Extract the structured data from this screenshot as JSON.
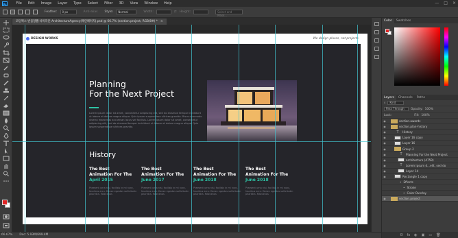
{
  "menubar": {
    "app_icon": "Ps",
    "items": [
      "File",
      "Edit",
      "Image",
      "Layer",
      "Type",
      "Select",
      "Filter",
      "3D",
      "View",
      "Window",
      "Help"
    ],
    "controls": [
      "—",
      "□",
      "×"
    ]
  },
  "options": {
    "feather_label": "Feather:",
    "feather_value": "0 px",
    "antialias_label": "Anti-alias",
    "style_label": "Style:",
    "style_value": "Normal",
    "width_label": "Width:",
    "height_label": "Height:",
    "select_mask_label": "Select and Mask..."
  },
  "doc_tab": {
    "title": "코딩웍스-반응형웹-사이자인-ArchitectureAgency(메인페이지).psd @ 66.7% (section.project, RGB/8#) *",
    "close": "×"
  },
  "canvas": {
    "brand": "DESIGN WORKS",
    "tagline": "We design places, not projects.",
    "heading_line1": "Planning",
    "heading_line2": "For the Next Project",
    "lorem": "Lorem ipsum dolor sit amet, consectetur adipiscing elit, sed do eiusmod tempor incididunt ut labore et dolore magna aliqua. Quis ipsum suspendisse ultrices gravida. Risus commodo viverra maecenas accumsan lacus vel facilisis. Lorem ipsum dolor sit amet, consectetur adipiscing elit, sed do eiusmod tempor incididunt ut labore et dolore magna aliqua. Quis ipsum suspendisse ultrices gravida.",
    "history_title": "History",
    "history": [
      {
        "line1": "The Best",
        "line2": "Animation For The",
        "date": "April 2015",
        "text": "Praesent urna nisi, facilisis in mi nunc, faucibus arcu. Donec egestas sollicitudin pharetra. Maecenas"
      },
      {
        "line1": "The Best",
        "line2": "Animation For The",
        "date": "June 2017",
        "text": "Praesent urna nisi, facilisis in mi nunc, faucibus arcu. Donec egestas sollicitudin pharetra. Maecenas"
      },
      {
        "line1": "The Best",
        "line2": "Animation For The",
        "date": "June 2018",
        "text": "Praesent urna nisi, facilisis in mi nunc, faucibus arcu. Donec egestas sollicitudin pharetra. Maecenas"
      },
      {
        "line1": "The Best",
        "line2": "Animation For The",
        "date": "June 2018",
        "text": "Praesent urna nisi, facilisis in mi nunc, faucibus arcu. Donec egestas sollicitudin pharetra. Maecenas"
      }
    ]
  },
  "status": {
    "zoom": "66.67%",
    "doc": "Doc: 5.93M/699.4M"
  },
  "color_panel": {
    "tabs": [
      "Color",
      "Swatches"
    ],
    "fg_color": "#e02424",
    "bg_color": "#ffffff"
  },
  "layers_panel": {
    "tabs": [
      "Layers",
      "Channels",
      "Paths"
    ],
    "kind_label": "Kind",
    "blend_mode": "Pass Through",
    "opacity_label": "Opacity:",
    "opacity_value": "100%",
    "lock_label": "Lock:",
    "fill_label": "Fill:",
    "fill_value": "100%",
    "layers": [
      {
        "name": "section.awards",
        "kind": "folder",
        "indent": 1
      },
      {
        "name": "section.plan-history",
        "kind": "folder",
        "indent": 1
      },
      {
        "name": "History",
        "kind": "text",
        "indent": 2
      },
      {
        "name": "Layer 16 copy",
        "kind": "image",
        "indent": 2
      },
      {
        "name": "Layer 16",
        "kind": "image",
        "indent": 2
      },
      {
        "name": "Group 2",
        "kind": "folder",
        "indent": 2
      },
      {
        "name": "Planning For the Next Project",
        "kind": "text",
        "indent": 3
      },
      {
        "name": "architecture (4759)",
        "kind": "image",
        "indent": 3
      },
      {
        "name": "Lorem ipsum d...elit, sed do",
        "kind": "text",
        "indent": 3
      },
      {
        "name": "Layer 14",
        "kind": "image",
        "indent": 3
      },
      {
        "name": "Rectangle 1 copy",
        "kind": "image",
        "indent": 2
      },
      {
        "name": "Effects",
        "kind": "fx",
        "indent": 3
      },
      {
        "name": "Stroke",
        "kind": "fx",
        "indent": 4
      },
      {
        "name": "Color Overlay",
        "kind": "fx",
        "indent": 4
      },
      {
        "name": "section.project",
        "kind": "folder",
        "indent": 1,
        "selected": true
      }
    ],
    "footer": [
      "ʘ",
      "fx",
      "◐",
      "▣",
      "▭",
      "🗑"
    ]
  },
  "accent": "#2ec4a6"
}
